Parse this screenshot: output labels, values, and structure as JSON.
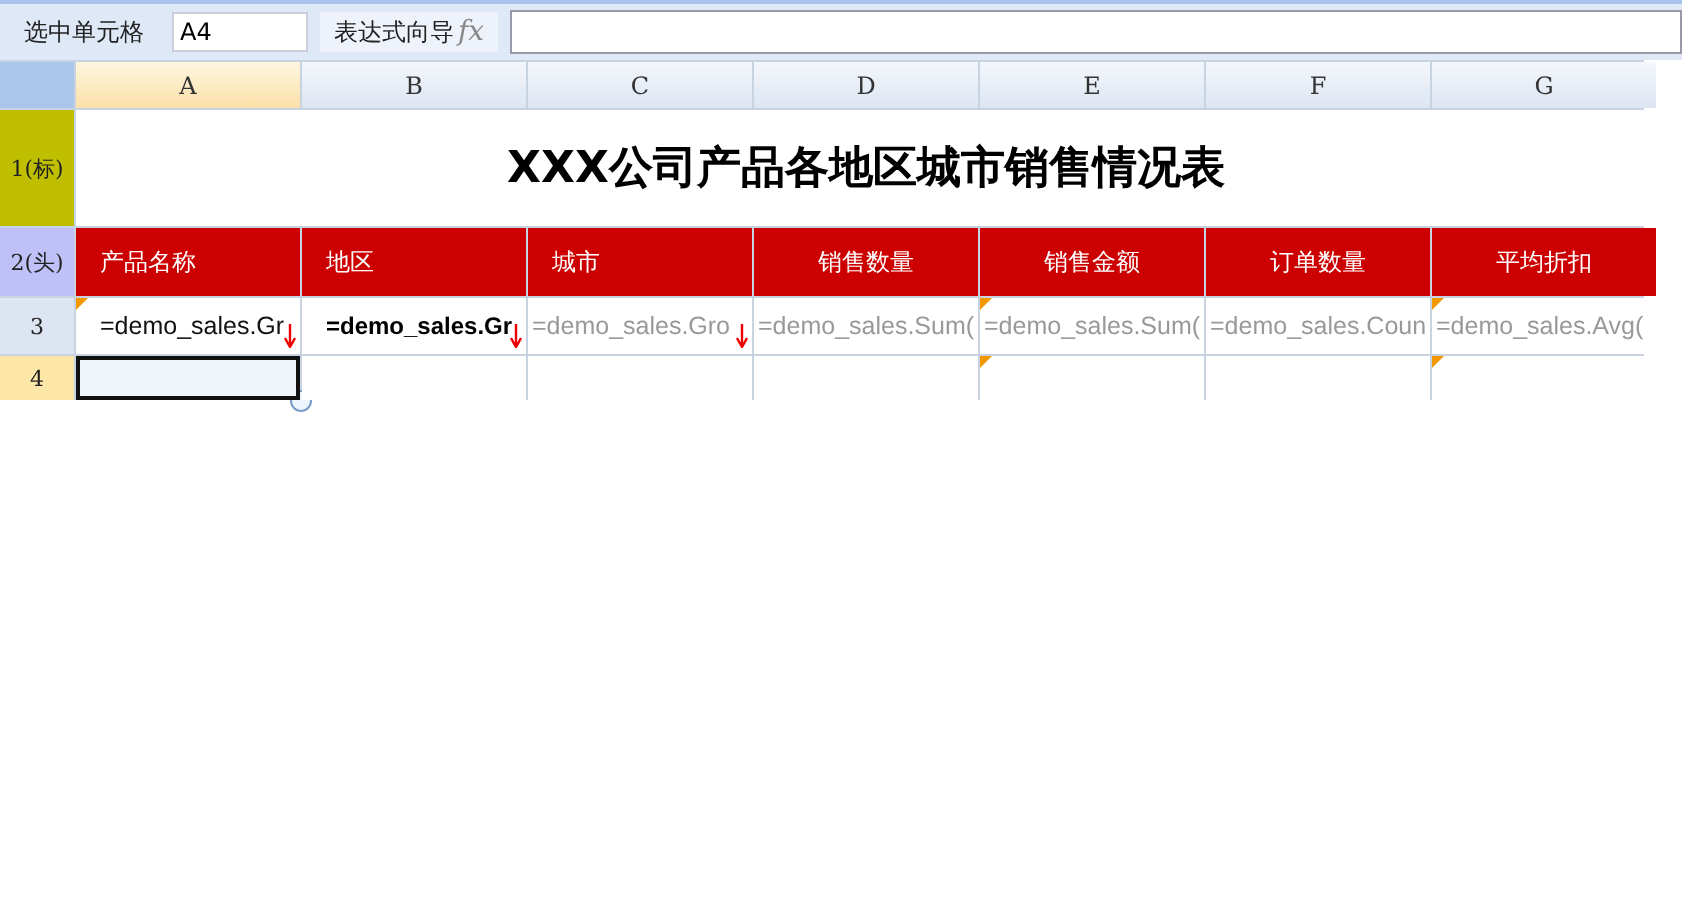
{
  "toolbar": {
    "cell_label": "选中单元格",
    "cell_ref": "A4",
    "expr_label": "表达式向导",
    "expr_icon": "fx"
  },
  "columns": [
    {
      "label": "A",
      "selected": true
    },
    {
      "label": "B",
      "selected": false
    },
    {
      "label": "C",
      "selected": false
    },
    {
      "label": "D",
      "selected": false
    },
    {
      "label": "E",
      "selected": false
    },
    {
      "label": "F",
      "selected": false
    },
    {
      "label": "G",
      "selected": false
    }
  ],
  "rows": [
    {
      "label": "1(标)",
      "kind": "title",
      "selected": false,
      "title": "XXX公司产品各地区城市销售情况表"
    },
    {
      "label": "2(头)",
      "kind": "header",
      "selected": false,
      "cells": [
        {
          "text": "产品名称",
          "kind": "dimension"
        },
        {
          "text": "地区",
          "kind": "dimension"
        },
        {
          "text": "城市",
          "kind": "dimension"
        },
        {
          "text": "销售数量",
          "kind": "measure"
        },
        {
          "text": "销售金额",
          "kind": "measure"
        },
        {
          "text": "订单数量",
          "kind": "measure"
        },
        {
          "text": "平均折扣",
          "kind": "measure"
        }
      ]
    },
    {
      "label": "3",
      "kind": "data",
      "selected": false,
      "cells": [
        {
          "text": "=demo_sales.Gr",
          "kind": "plain",
          "flagged": true,
          "expand": true,
          "selected": false
        },
        {
          "text": "=demo_sales.Gr",
          "kind": "strong",
          "flagged": false,
          "expand": true,
          "selected": false
        },
        {
          "text": "=demo_sales.Gro",
          "kind": "muted",
          "flagged": false,
          "expand": true,
          "selected": false
        },
        {
          "text": "=demo_sales.Sum(",
          "kind": "muted",
          "flagged": false,
          "expand": false,
          "selected": false
        },
        {
          "text": "=demo_sales.Sum(",
          "kind": "muted",
          "flagged": true,
          "expand": false,
          "selected": false
        },
        {
          "text": "=demo_sales.Coun",
          "kind": "muted",
          "flagged": false,
          "expand": false,
          "selected": false
        },
        {
          "text": "=demo_sales.Avg(",
          "kind": "muted",
          "flagged": true,
          "expand": false,
          "selected": false
        }
      ]
    },
    {
      "label": "4",
      "kind": "data",
      "selected": true,
      "cells": [
        {
          "flagged": false,
          "expand": false,
          "selected": true
        },
        {
          "flagged": false,
          "expand": false,
          "selected": false
        },
        {
          "flagged": false,
          "expand": false,
          "selected": false
        },
        {
          "flagged": false,
          "expand": false,
          "selected": false
        },
        {
          "flagged": true,
          "expand": false,
          "selected": false
        },
        {
          "flagged": false,
          "expand": false,
          "selected": false
        },
        {
          "flagged": true,
          "expand": false,
          "selected": false
        }
      ]
    }
  ]
}
